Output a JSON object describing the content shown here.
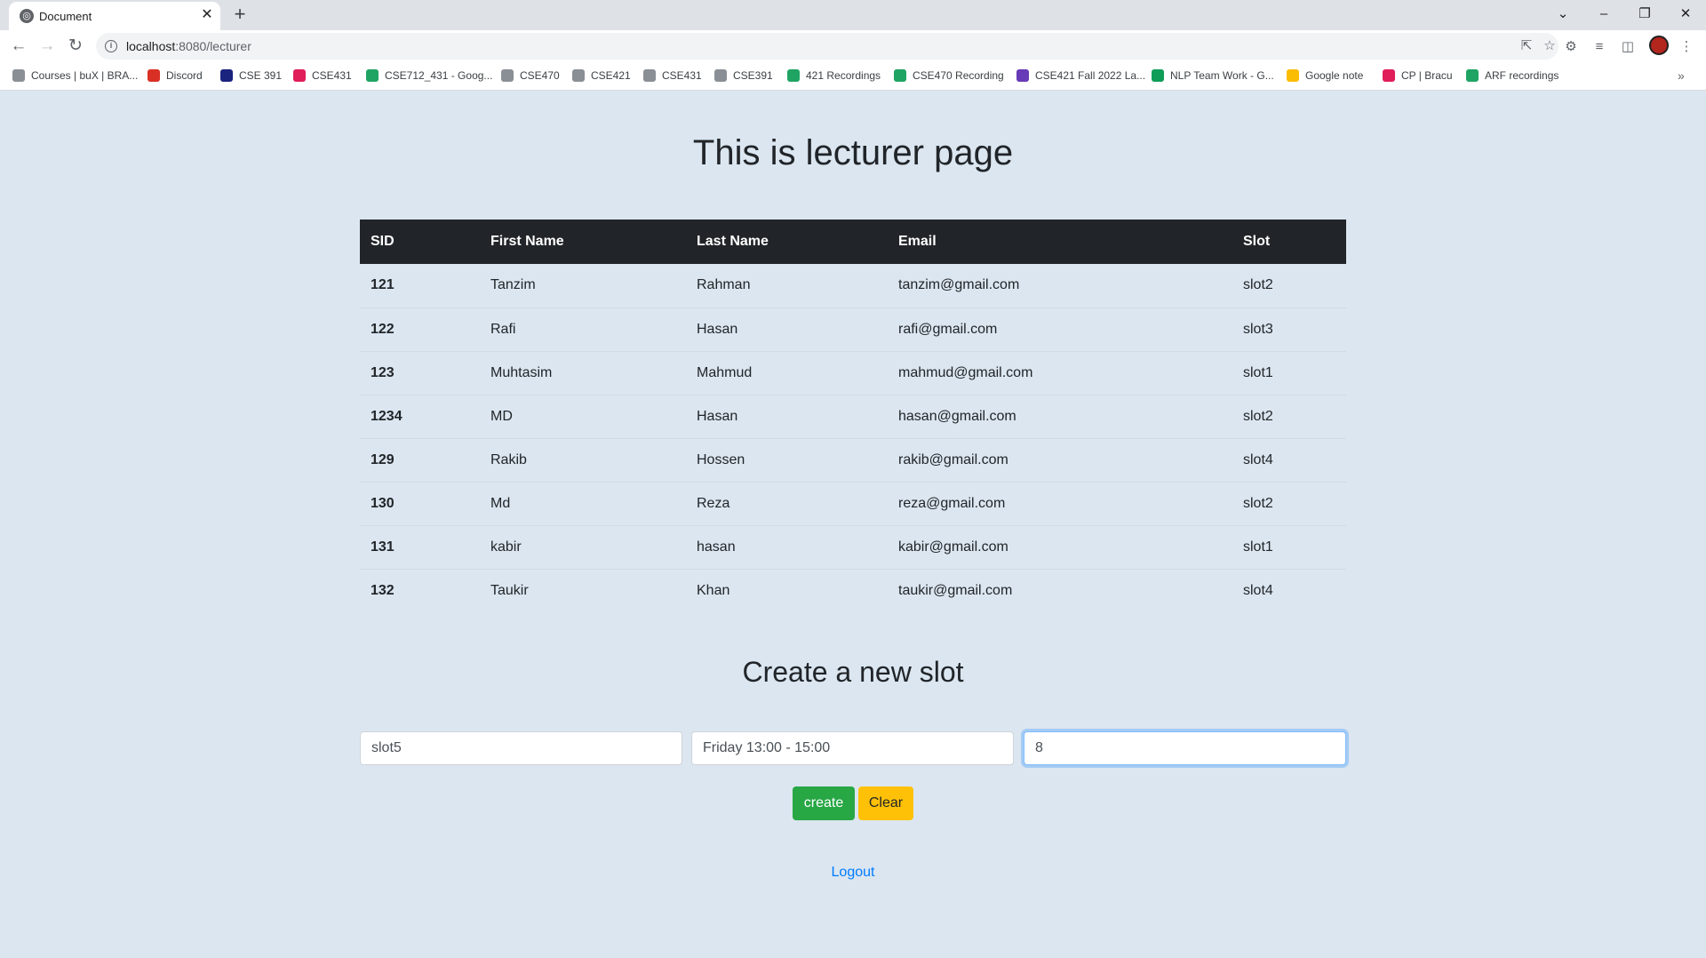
{
  "browser": {
    "tab_title": "Document",
    "url_host": "localhost",
    "url_rest": ":8080/lecturer",
    "bookmarks": [
      {
        "label": "Courses | buX | BRA...",
        "color": "#8a8f95"
      },
      {
        "label": "Discord",
        "color": "#d93025"
      },
      {
        "label": "CSE 391",
        "color": "#1a237e"
      },
      {
        "label": "CSE431",
        "color": "#e01e5a"
      },
      {
        "label": "CSE712_431 - Goog...",
        "color": "#1fa463"
      },
      {
        "label": "CSE470",
        "color": "#8a8f95"
      },
      {
        "label": "CSE421",
        "color": "#8a8f95"
      },
      {
        "label": "CSE431",
        "color": "#8a8f95"
      },
      {
        "label": "CSE391",
        "color": "#8a8f95"
      },
      {
        "label": "421 Recordings",
        "color": "#1fa463"
      },
      {
        "label": "CSE470 Recording",
        "color": "#1fa463"
      },
      {
        "label": "CSE421 Fall 2022 La...",
        "color": "#673ab7"
      },
      {
        "label": "NLP Team Work - G...",
        "color": "#0f9d58"
      },
      {
        "label": "Google note",
        "color": "#fbbc04"
      },
      {
        "label": "CP | Bracu",
        "color": "#e01e5a"
      },
      {
        "label": "ARF recordings",
        "color": "#1fa463"
      }
    ]
  },
  "page": {
    "title": "This is lecturer page",
    "table": {
      "headers": [
        "SID",
        "First Name",
        "Last Name",
        "Email",
        "Slot"
      ],
      "rows": [
        [
          "121",
          "Tanzim",
          "Rahman",
          "tanzim@gmail.com",
          "slot2"
        ],
        [
          "122",
          "Rafi",
          "Hasan",
          "rafi@gmail.com",
          "slot3"
        ],
        [
          "123",
          "Muhtasim",
          "Mahmud",
          "mahmud@gmail.com",
          "slot1"
        ],
        [
          "1234",
          "MD",
          "Hasan",
          "hasan@gmail.com",
          "slot2"
        ],
        [
          "129",
          "Rakib",
          "Hossen",
          "rakib@gmail.com",
          "slot4"
        ],
        [
          "130",
          "Md",
          "Reza",
          "reza@gmail.com",
          "slot2"
        ],
        [
          "131",
          "kabir",
          "hasan",
          "kabir@gmail.com",
          "slot1"
        ],
        [
          "132",
          "Taukir",
          "Khan",
          "taukir@gmail.com",
          "slot4"
        ]
      ]
    },
    "form": {
      "title": "Create a new slot",
      "slot_name_value": "slot5",
      "slot_time_value": "Friday 13:00 - 15:00",
      "capacity_value": "8",
      "create_label": "create",
      "clear_label": "Clear"
    },
    "logout_label": "Logout"
  },
  "colors": {
    "page_bg": "#dbe6f0",
    "header_bg": "#212529",
    "create_btn": "#28a745",
    "clear_btn": "#ffc107",
    "link": "#007bff"
  }
}
